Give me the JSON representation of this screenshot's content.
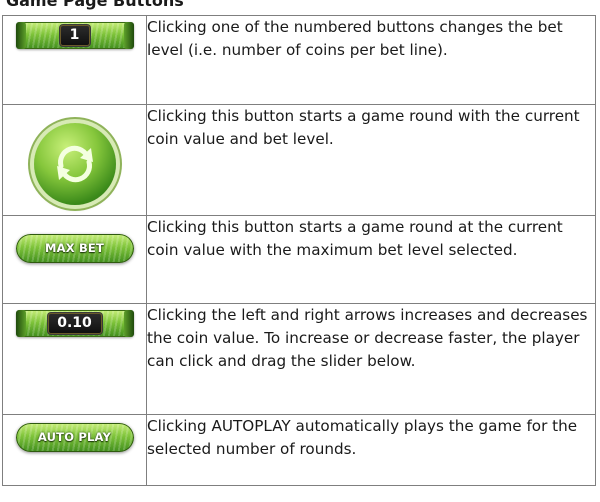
{
  "heading": "Game Page Buttons",
  "rows": [
    {
      "icon": "bet-level-button",
      "value": "1",
      "description": "Clicking one of the numbered buttons changes the bet level (i.e. number of coins per bet line)."
    },
    {
      "icon": "spin-button",
      "description": "Clicking this button starts a game round with the current coin value and bet level."
    },
    {
      "icon": "max-bet-button",
      "label": "MAX BET",
      "description": "Clicking this button starts a game round at the current coin value with the maximum bet level selected."
    },
    {
      "icon": "coin-value-button",
      "value": "0.10",
      "description": "Clicking the left and right arrows increases and decreases the coin value. To increase or decrease faster, the player can click and drag the slider below."
    },
    {
      "icon": "autoplay-button",
      "label": "AUTO PLAY",
      "description": "Clicking AUTOPLAY automatically plays the game for the selected number of rounds."
    }
  ],
  "colors": {
    "grass_light": "#c8ef7a",
    "grass_mid": "#7fc43a",
    "grass_dark": "#3f8d1c",
    "border": "#7f7f7f"
  }
}
